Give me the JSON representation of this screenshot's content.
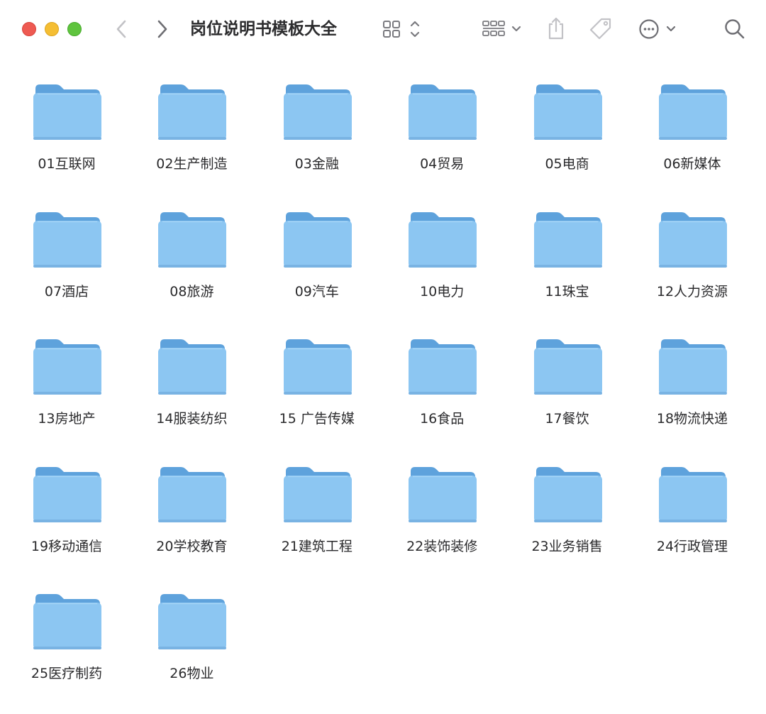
{
  "window": {
    "title": "岗位说明书模板大全"
  },
  "toolbar": {
    "icons": [
      "chevron-left-icon",
      "chevron-right-icon",
      "icon-view-grid-icon",
      "group-by-icon",
      "share-icon",
      "tag-icon",
      "more-actions-icon",
      "search-icon"
    ]
  },
  "colors": {
    "folder_body": "#8cc6f2",
    "folder_back": "#5ea2dc",
    "close": "#ee5a52",
    "minimize": "#f5be33",
    "maximize": "#5fc43e",
    "toolbar_icon": "#8e8e93"
  },
  "folders": [
    {
      "label": "01互联网"
    },
    {
      "label": "02生产制造"
    },
    {
      "label": "03金融"
    },
    {
      "label": "04贸易"
    },
    {
      "label": "05电商"
    },
    {
      "label": "06新媒体"
    },
    {
      "label": "07酒店"
    },
    {
      "label": "08旅游"
    },
    {
      "label": "09汽车"
    },
    {
      "label": "10电力"
    },
    {
      "label": "11珠宝"
    },
    {
      "label": "12人力资源"
    },
    {
      "label": "13房地产"
    },
    {
      "label": "14服装纺织"
    },
    {
      "label": "15 广告传媒"
    },
    {
      "label": "16食品"
    },
    {
      "label": "17餐饮"
    },
    {
      "label": "18物流快递"
    },
    {
      "label": "19移动通信"
    },
    {
      "label": "20学校教育"
    },
    {
      "label": "21建筑工程"
    },
    {
      "label": "22装饰装修"
    },
    {
      "label": "23业务销售"
    },
    {
      "label": "24行政管理"
    },
    {
      "label": "25医疗制药"
    },
    {
      "label": "26物业"
    }
  ]
}
